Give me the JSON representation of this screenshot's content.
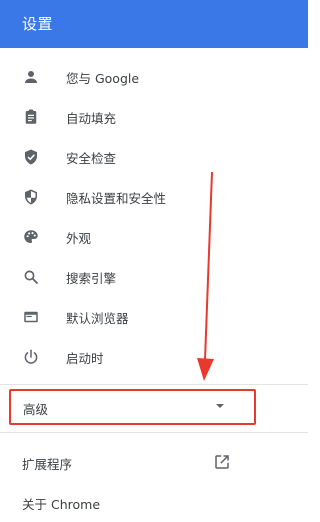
{
  "header": {
    "title": "设置"
  },
  "nav": {
    "items": [
      {
        "label": "您与 Google",
        "icon": "person-icon"
      },
      {
        "label": "自动填充",
        "icon": "clipboard-icon"
      },
      {
        "label": "安全检查",
        "icon": "shield-check-icon"
      },
      {
        "label": "隐私设置和安全性",
        "icon": "shield-half-icon"
      },
      {
        "label": "外观",
        "icon": "palette-icon"
      },
      {
        "label": "搜索引擎",
        "icon": "search-icon"
      },
      {
        "label": "默认浏览器",
        "icon": "browser-icon"
      },
      {
        "label": "启动时",
        "icon": "power-icon"
      }
    ]
  },
  "advanced": {
    "label": "高级",
    "icon": "caret-down-icon"
  },
  "bottom": {
    "extensions_label": "扩展程序",
    "extensions_icon": "open-in-new-icon",
    "about_label": "关于 Chrome"
  },
  "colors": {
    "header_bg": "#3b78e7",
    "annotation_red": "#e8392e",
    "icon_gray": "#5f6368"
  }
}
